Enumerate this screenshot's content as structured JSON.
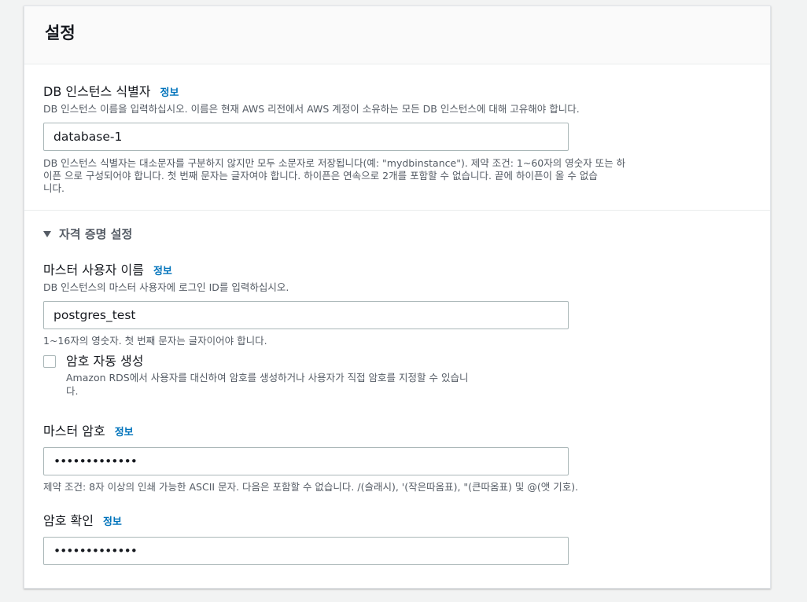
{
  "settings": {
    "title": "설정"
  },
  "db_identifier": {
    "label": "DB 인스턴스 식별자",
    "info": "정보",
    "description": "DB 인스턴스 이름을 입력하십시오. 이름은 현재 AWS 리전에서 AWS 계정이 소유하는 모든 DB 인스턴스에 대해 고유해야 합니다.",
    "value": "database-1",
    "constraint_line1": "DB 인스턴스 식별자는 대소문자를 구분하지 않지만 모두 소문자로 저장됩니다(예: \"mydbinstance\"). 제약 조건: 1~60자의 영숫자 또는 하",
    "constraint_line2": "이픈 으로 구성되어야 합니다. 첫 번째 문자는 글자여야 합니다. 하이픈은 연속으로 2개를 포함할 수 없습니다. 끝에 하이픈이 올 수 없습",
    "constraint_line3": "니다."
  },
  "credentials": {
    "section_label": "자격 증명 설정",
    "expanded": true,
    "master_username": {
      "label": "마스터 사용자 이름",
      "info": "정보",
      "description": "DB 인스턴스의 마스터 사용자에 로그인 ID를 입력하십시오.",
      "value": "postgres_test",
      "constraint": "1~16자의 영숫자. 첫 번째 문자는 글자이어야 합니다."
    },
    "auto_generate": {
      "label": "암호 자동 생성",
      "checked": false,
      "description_line1": "Amazon RDS에서 사용자를 대신하여 암호를 생성하거나 사용자가 직접 암호를 지정할 수 있습니",
      "description_line2": "다."
    },
    "master_password": {
      "label": "마스터 암호",
      "info": "정보",
      "value": "•••••••••••••",
      "constraint": "제약 조건: 8자 이상의 인쇄 가능한 ASCII 문자. 다음은 포함할 수 없습니다. /(슬래시), '(작은따옴표), \"(큰따옴표) 및 @(앳 기호)."
    },
    "confirm_password": {
      "label": "암호 확인",
      "info": "정보",
      "value": "•••••••••••••"
    }
  },
  "colors": {
    "link": "#0073bb",
    "text": "#16191f",
    "secondary_text": "#545b64",
    "border": "#aab7b8",
    "header_bg": "#fafafa",
    "page_bg": "#f2f3f3"
  }
}
